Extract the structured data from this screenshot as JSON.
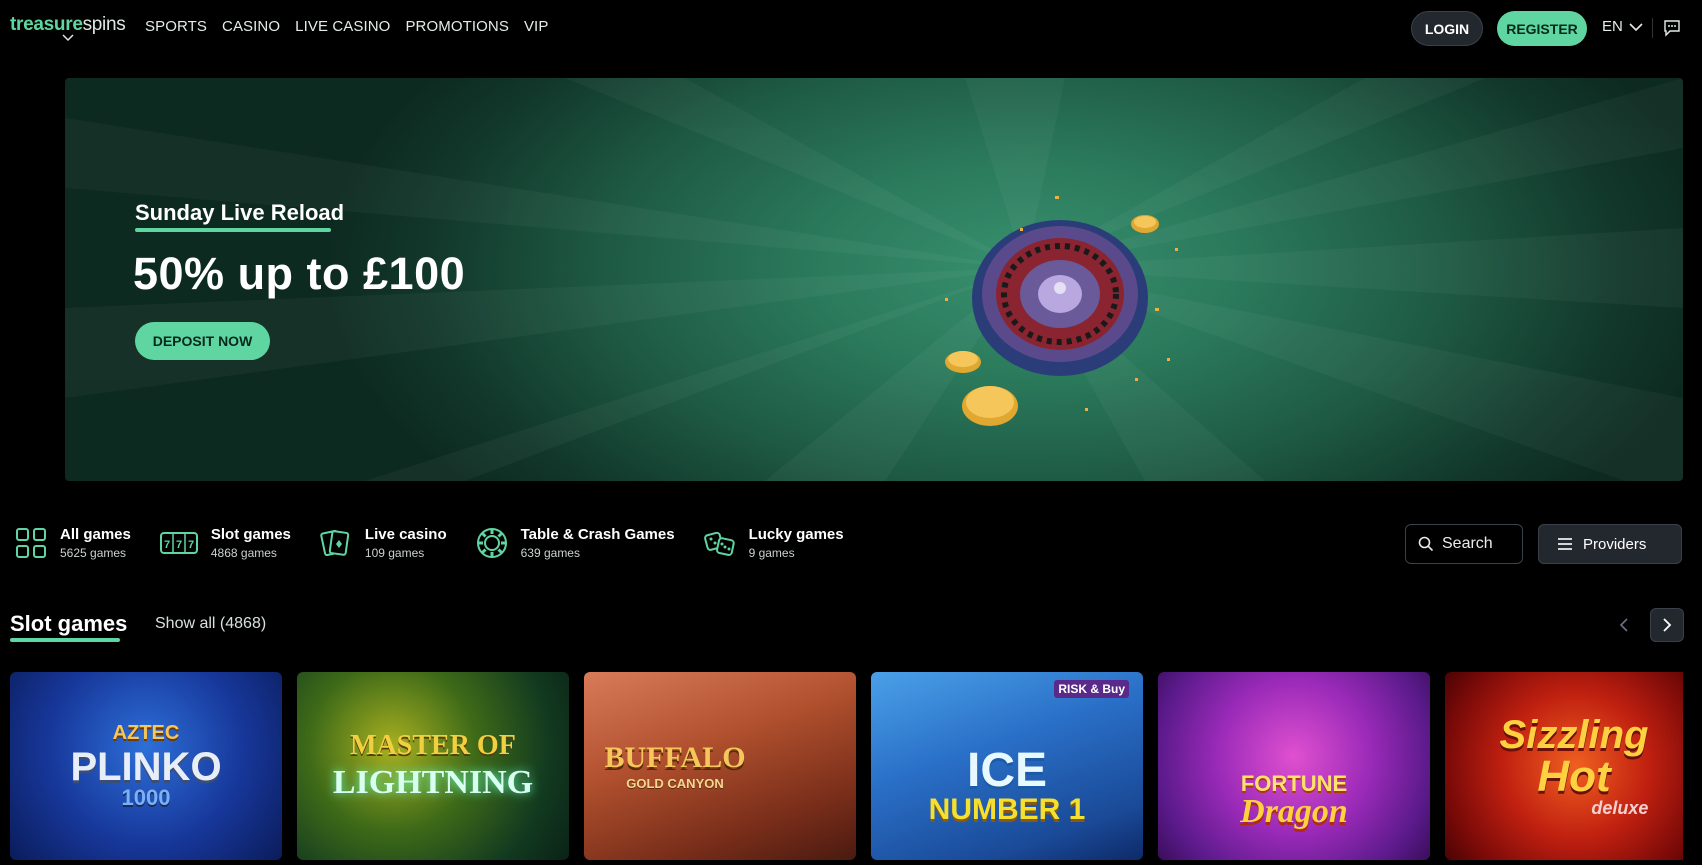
{
  "header": {
    "logo_part1": "treasure",
    "logo_part2": "spins",
    "nav": [
      "SPORTS",
      "CASINO",
      "LIVE CASINO",
      "PROMOTIONS",
      "VIP"
    ],
    "login_label": "LOGIN",
    "register_label": "REGISTER",
    "language": "EN"
  },
  "banner": {
    "subtitle": "Sunday Live Reload",
    "title": "50% up to £100",
    "cta_label": "DEPOSIT NOW"
  },
  "categories": [
    {
      "name": "All games",
      "count": "5625 games",
      "icon": "grid-icon"
    },
    {
      "name": "Slot games",
      "count": "4868 games",
      "icon": "slot-777-icon"
    },
    {
      "name": "Live casino",
      "count": "109 games",
      "icon": "cards-icon"
    },
    {
      "name": "Table & Crash Games",
      "count": "639 games",
      "icon": "chip-icon"
    },
    {
      "name": "Lucky games",
      "count": "9 games",
      "icon": "dice-icon"
    }
  ],
  "search": {
    "placeholder": "Search"
  },
  "providers_label": "Providers",
  "section": {
    "title": "Slot games",
    "show_all": "Show all (4868)"
  },
  "games": [
    {
      "line1": "AZTEC",
      "line2": "PLINKO",
      "line3": "1000"
    },
    {
      "line1": "MASTER OF",
      "line2": "LIGHTNING",
      "line3": ""
    },
    {
      "line1": "BUFFALO",
      "line2": "GOLD CANYON",
      "line3": ""
    },
    {
      "line1": "ICE",
      "line2": "NUMBER 1",
      "line3": "RISK & Buy"
    },
    {
      "line1": "FORTUNE",
      "line2": "Dragon",
      "line3": ""
    },
    {
      "line1": "Sizzling",
      "line2": "Hot",
      "line3": "deluxe"
    }
  ],
  "colors": {
    "accent": "#5fd6a2",
    "background": "#000000",
    "button_dark": "#23282f"
  }
}
